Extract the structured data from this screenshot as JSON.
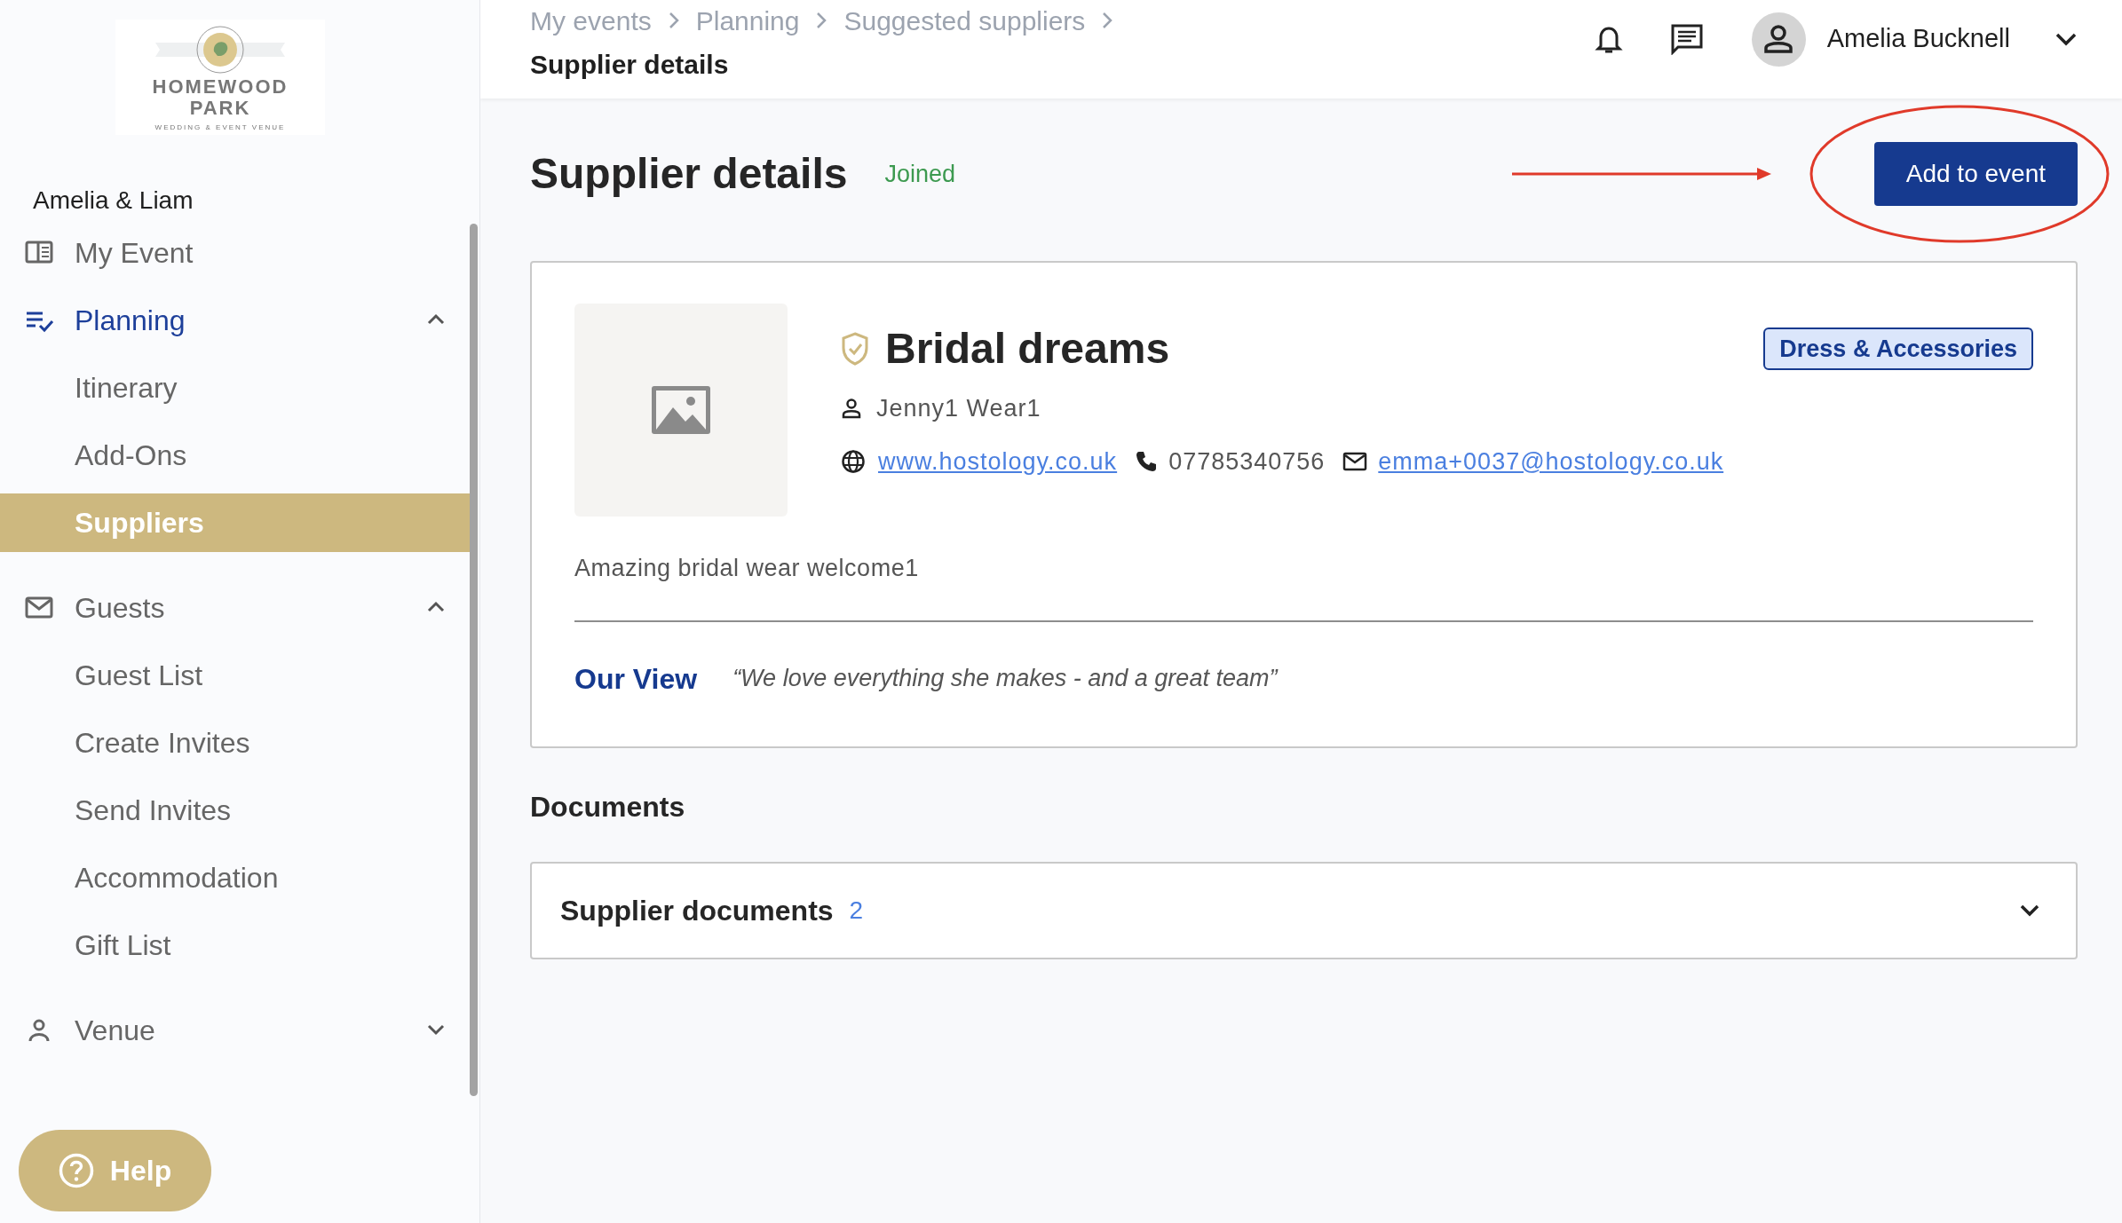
{
  "logo": {
    "name": "HOMEWOOD PARK",
    "tagline": "WEDDING & EVENT VENUE"
  },
  "couple": "Amelia & Liam",
  "nav": [
    {
      "label": "My Event",
      "selected": false
    },
    {
      "label": "Planning",
      "selected": true,
      "expanded": true,
      "children": [
        {
          "label": "Itinerary",
          "selected": false
        },
        {
          "label": "Add-Ons",
          "selected": false
        },
        {
          "label": "Suppliers",
          "selected": true
        }
      ]
    },
    {
      "label": "Guests",
      "selected": false,
      "expanded": true,
      "children": [
        {
          "label": "Guest List",
          "selected": false
        },
        {
          "label": "Create Invites",
          "selected": false
        },
        {
          "label": "Send Invites",
          "selected": false
        },
        {
          "label": "Accommodation",
          "selected": false
        },
        {
          "label": "Gift List",
          "selected": false
        }
      ]
    },
    {
      "label": "Venue",
      "selected": false,
      "expanded": false
    }
  ],
  "help": "Help",
  "header": {
    "breadcrumb": [
      "My events",
      "Planning",
      "Suggested suppliers"
    ],
    "current": "Supplier details",
    "user": "Amelia Bucknell"
  },
  "page": {
    "title": "Supplier details",
    "status": "Joined",
    "action": "Add to event"
  },
  "supplier": {
    "verified": true,
    "name": "Bridal dreams",
    "category": "Dress & Accessories",
    "contact": "Jenny1 Wear1",
    "website": "www.hostology.co.uk",
    "phone": "07785340756",
    "email": "emma+0037@hostology.co.uk",
    "description": "Amazing bridal wear welcome1",
    "view_label": "Our View",
    "view": "“We love everything she makes - and a great team”"
  },
  "documents": {
    "heading": "Documents",
    "accordion": {
      "title": "Supplier documents",
      "count": "2",
      "expanded": false
    }
  }
}
